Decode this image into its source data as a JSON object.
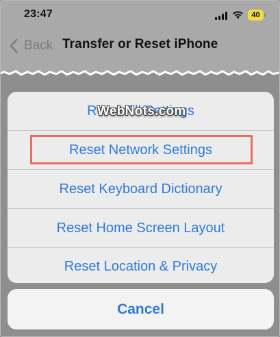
{
  "status_bar": {
    "time": "23:47",
    "battery_level": "40",
    "signal_icon": "cellular-signal-icon",
    "wifi_icon": "wifi-icon",
    "battery_color": "#f0df3a"
  },
  "nav": {
    "back_label": "Back",
    "back_icon": "chevron-left-icon",
    "title": "Transfer or Reset iPhone"
  },
  "action_sheet": {
    "items": [
      {
        "label": "Reset All Settings"
      },
      {
        "label": "Reset Network Settings"
      },
      {
        "label": "Reset Keyboard Dictionary"
      },
      {
        "label": "Reset Home Screen Layout"
      },
      {
        "label": "Reset Location & Privacy"
      }
    ],
    "highlighted_item": "Reset Network Settings",
    "highlight_color": "#ef6a5b"
  },
  "cancel": {
    "label": "Cancel"
  },
  "watermark": {
    "text": "WebNots.com"
  },
  "colors": {
    "accent": "#2f7ad9",
    "sheet_bg": "#ececec",
    "dim_bg": "#8e8e8e"
  }
}
